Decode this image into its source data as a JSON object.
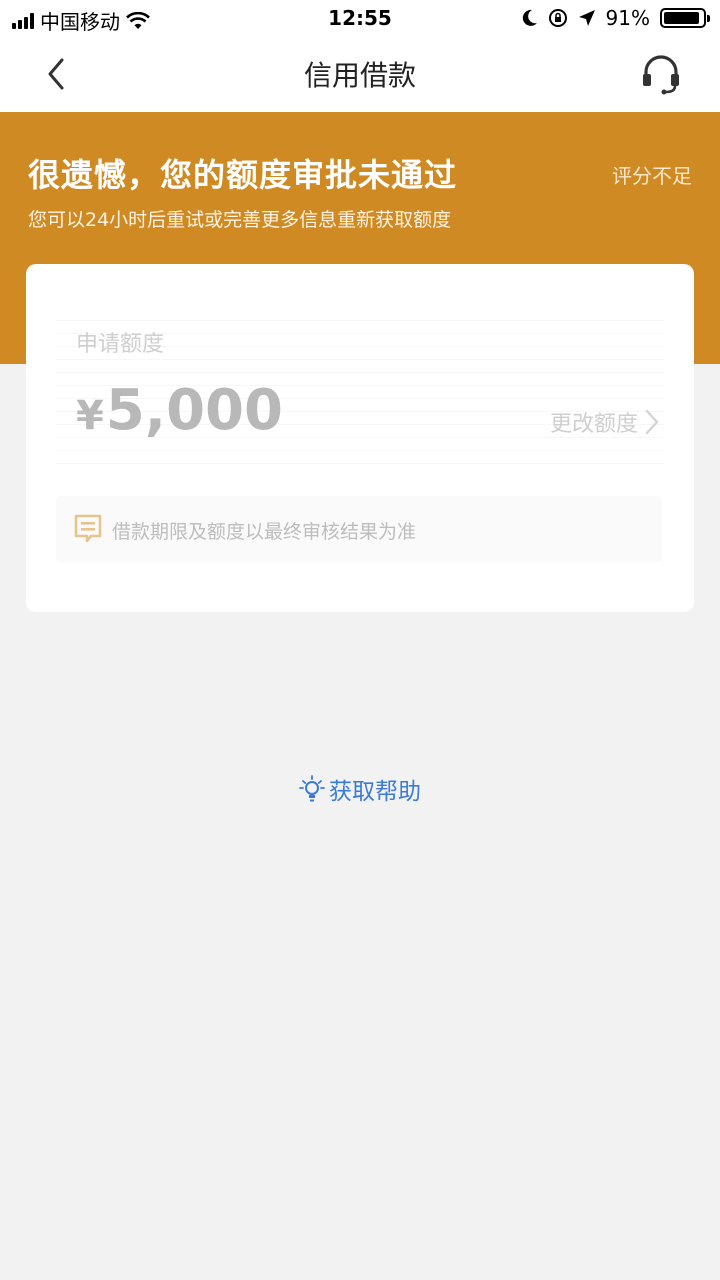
{
  "status_bar": {
    "carrier": "中国移动",
    "time": "12:55",
    "battery_percent": "91%",
    "battery_level": 0.91,
    "icons": [
      "signal-icon",
      "wifi-icon",
      "moon-icon",
      "rotation-lock-icon",
      "location-arrow-icon",
      "battery-icon"
    ]
  },
  "nav": {
    "title": "信用借款",
    "back_icon": "chevron-left-icon",
    "service_icon": "headset-icon"
  },
  "banner": {
    "title": "很遗憾，您的额度审批未通过",
    "tag": "评分不足",
    "subtitle": "您可以24小时后重试或完善更多信息重新获取额度",
    "color": "#d08a24"
  },
  "card": {
    "amount_label": "申请额度",
    "currency": "¥",
    "amount": "5,000",
    "change_label": "更改额度",
    "notice_text": "借款期限及额度以最终审核结果为准",
    "notice_icon": "message-icon",
    "notice_icon_color": "#e6c48f"
  },
  "help": {
    "label": "获取帮助",
    "icon": "lightbulb-icon",
    "color": "#3a7bd5"
  }
}
